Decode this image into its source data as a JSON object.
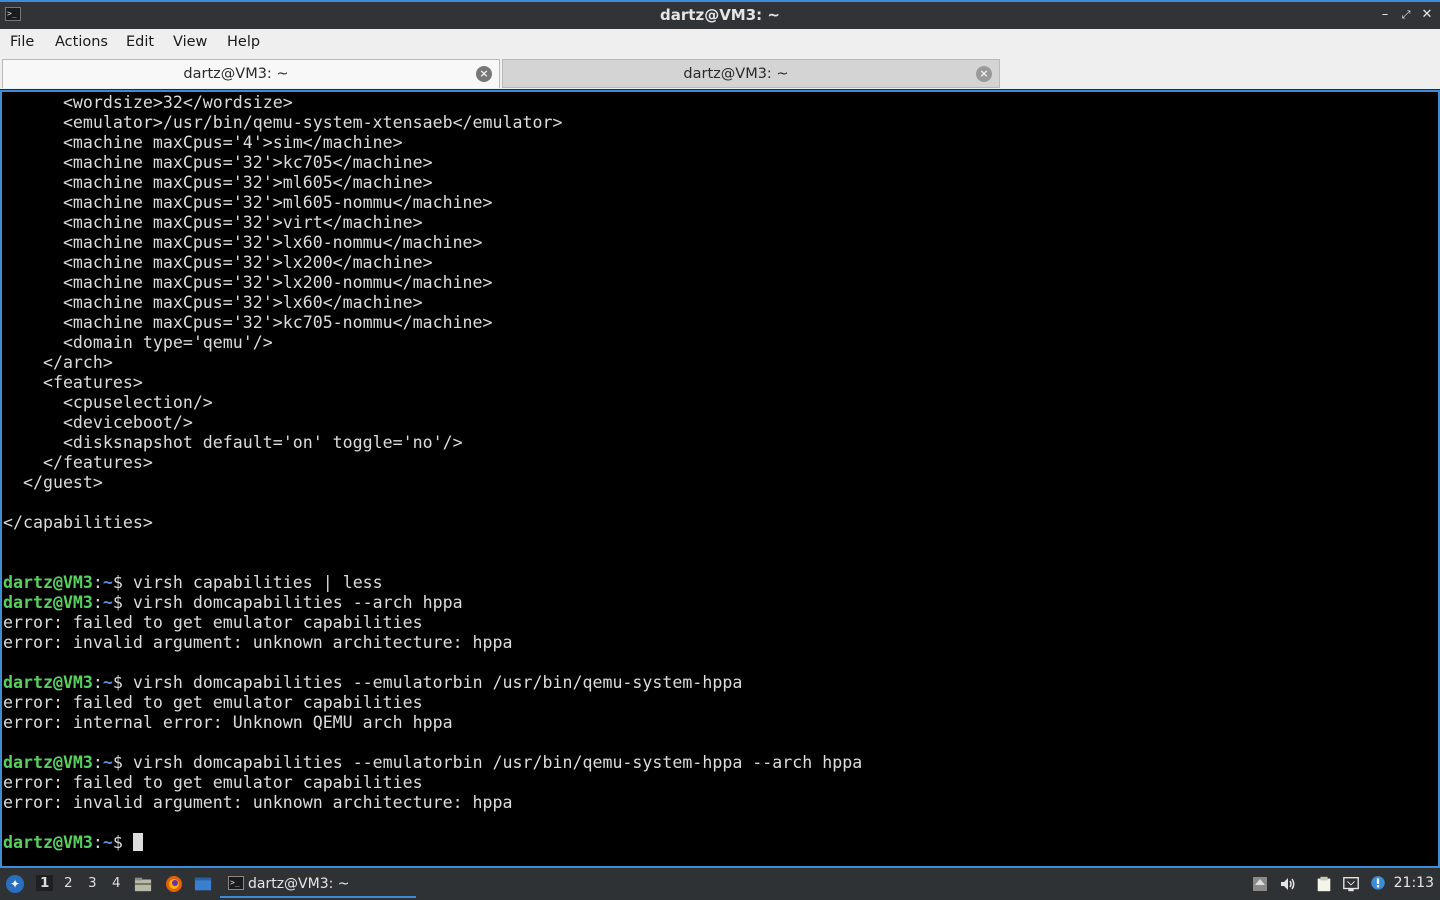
{
  "window": {
    "title": "dartz@VM3: ~",
    "app_icon": "terminal-icon",
    "buttons": {
      "minimize": "–",
      "restore": "⤢",
      "close": "✕"
    }
  },
  "menu": [
    "File",
    "Actions",
    "Edit",
    "View",
    "Help"
  ],
  "tabs": [
    {
      "label": "dartz@VM3: ~",
      "active": true
    },
    {
      "label": "dartz@VM3: ~",
      "active": false
    }
  ],
  "terminal": {
    "prompt": {
      "user": "dartz@VM3",
      "sep": ":",
      "path": "~",
      "symbol": "$ "
    },
    "lines": [
      {
        "text": "      <wordsize>32</wordsize>"
      },
      {
        "text": "      <emulator>/usr/bin/qemu-system-xtensaeb</emulator>"
      },
      {
        "text": "      <machine maxCpus='4'>sim</machine>"
      },
      {
        "text": "      <machine maxCpus='32'>kc705</machine>"
      },
      {
        "text": "      <machine maxCpus='32'>ml605</machine>"
      },
      {
        "text": "      <machine maxCpus='32'>ml605-nommu</machine>"
      },
      {
        "text": "      <machine maxCpus='32'>virt</machine>"
      },
      {
        "text": "      <machine maxCpus='32'>lx60-nommu</machine>"
      },
      {
        "text": "      <machine maxCpus='32'>lx200</machine>"
      },
      {
        "text": "      <machine maxCpus='32'>lx200-nommu</machine>"
      },
      {
        "text": "      <machine maxCpus='32'>lx60</machine>"
      },
      {
        "text": "      <machine maxCpus='32'>kc705-nommu</machine>"
      },
      {
        "text": "      <domain type='qemu'/>"
      },
      {
        "text": "    </arch>"
      },
      {
        "text": "    <features>"
      },
      {
        "text": "      <cpuselection/>"
      },
      {
        "text": "      <deviceboot/>"
      },
      {
        "text": "      <disksnapshot default='on' toggle='no'/>"
      },
      {
        "text": "    </features>"
      },
      {
        "text": "  </guest>"
      },
      {
        "text": ""
      },
      {
        "text": "</capabilities>"
      },
      {
        "text": ""
      },
      {
        "text": ""
      },
      {
        "cmd": "virsh capabilities | less"
      },
      {
        "cmd": "virsh domcapabilities --arch hppa"
      },
      {
        "text": "error: failed to get emulator capabilities"
      },
      {
        "text": "error: invalid argument: unknown architecture: hppa"
      },
      {
        "text": ""
      },
      {
        "cmd": "virsh domcapabilities --emulatorbin /usr/bin/qemu-system-hppa"
      },
      {
        "text": "error: failed to get emulator capabilities"
      },
      {
        "text": "error: internal error: Unknown QEMU arch hppa"
      },
      {
        "text": ""
      },
      {
        "cmd": "virsh domcapabilities --emulatorbin /usr/bin/qemu-system-hppa --arch hppa"
      },
      {
        "text": "error: failed to get emulator capabilities"
      },
      {
        "text": "error: invalid argument: unknown architecture: hppa"
      },
      {
        "text": ""
      },
      {
        "cmd": "",
        "cursor": true
      }
    ]
  },
  "taskbar": {
    "workspaces": [
      "1",
      "2",
      "3",
      "4"
    ],
    "active_workspace": "1",
    "launchers": [
      "file-manager-icon",
      "firefox-icon",
      "desktop-icon"
    ],
    "task": {
      "label": "dartz@VM3: ~",
      "icon": "terminal-icon"
    },
    "tray": [
      "update-notifier-icon",
      "volume-icon",
      "clipboard-icon",
      "network-icon",
      "notification-icon"
    ],
    "clock": "21:13"
  },
  "colors": {
    "accent": "#3c8dd6",
    "prompt_user": "#57d15f",
    "prompt_path": "#5a8fd8"
  }
}
